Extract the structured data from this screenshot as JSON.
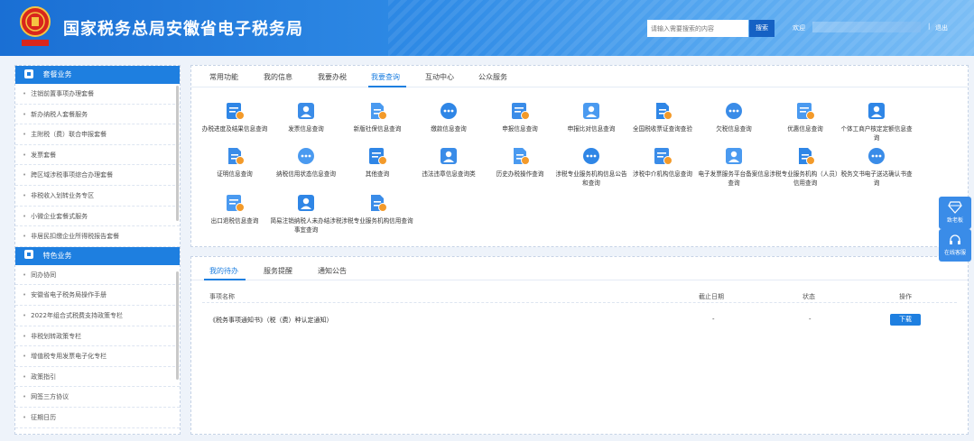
{
  "header": {
    "title": "国家税务总局安徽省电子税务局",
    "search_placeholder": "请输入需要搜索的内容",
    "search_button": "搜索",
    "welcome": "欢迎",
    "separator": "|",
    "logout": "退出",
    "colors": {
      "brand": "#1a6fd4",
      "brand_light": "#7cbef5"
    }
  },
  "sidebar": {
    "sections": [
      {
        "title": "套餐业务",
        "items": [
          "注销前置事项办理套餐",
          "新办纳税人套餐服务",
          "主附税（费）联合申报套餐",
          "发票套餐",
          "跨区域涉税事项综合办理套餐",
          "非税收入划转业务专区",
          "小微企业套餐式服务",
          "非居民扣缴企业所得税报告套餐"
        ]
      },
      {
        "title": "特色业务",
        "items": [
          "同办协同",
          "安徽省电子税务局操作手册",
          "2022年组合式税费支持政策专栏",
          "非税划转政策专栏",
          "增值税专用发票电子化专栏",
          "政策指引",
          "网签三方协议",
          "征期日历"
        ]
      }
    ]
  },
  "main_tabs": {
    "tabs": [
      "常用功能",
      "我的信息",
      "我要办税",
      "我要查询",
      "互动中心",
      "公众服务"
    ],
    "active": "我要查询"
  },
  "query_items": [
    {
      "label": "办税进度及结果信息查询",
      "icon": "search-progress-icon"
    },
    {
      "label": "发票信息查询",
      "icon": "invoice-icon"
    },
    {
      "label": "新版社保信息查询",
      "icon": "social-security-icon"
    },
    {
      "label": "缴款信息查询",
      "icon": "payment-icon"
    },
    {
      "label": "申报信息查询",
      "icon": "declaration-icon"
    },
    {
      "label": "申报比对信息查询",
      "icon": "compare-icon"
    },
    {
      "label": "全国税收票证查询查验",
      "icon": "tax-ticket-icon"
    },
    {
      "label": "欠税信息查询",
      "icon": "arrears-icon"
    },
    {
      "label": "优惠信息查询",
      "icon": "preferential-icon"
    },
    {
      "label": "个体工商户核定定额信息查询",
      "icon": "quota-icon"
    },
    {
      "label": "证明信息查询",
      "icon": "certificate-icon"
    },
    {
      "label": "纳税信用状态信息查询",
      "icon": "credit-icon"
    },
    {
      "label": "其他查询",
      "icon": "more-icon"
    },
    {
      "label": "违法违章信息查询类",
      "icon": "violation-icon"
    },
    {
      "label": "历史办税操作查询",
      "icon": "history-icon"
    },
    {
      "label": "涉税专业服务机构信息公告和查询",
      "icon": "agency-icon"
    },
    {
      "label": "涉税中介机构信息查询",
      "icon": "intermediary-icon"
    },
    {
      "label": "电子发票服务平台备案信息查询",
      "icon": "e-invoice-icon"
    },
    {
      "label": "涉税专业服务机构（人员）信用查询",
      "icon": "agency-staff-icon"
    },
    {
      "label": "税务文书电子送达确认书查询",
      "icon": "document-icon"
    },
    {
      "label": "出口退税信息查询",
      "icon": "export-refund-icon"
    },
    {
      "label": "简易注销纳税人未办结涉税事宜查询",
      "icon": "deregister-icon"
    },
    {
      "label": "涉税专业服务机构信用查询",
      "icon": "agency-credit-icon"
    }
  ],
  "bottom_tabs": {
    "tabs": [
      "我的待办",
      "服务提醒",
      "通知公告"
    ],
    "active": "我的待办"
  },
  "todo_table": {
    "headers": {
      "name": "事项名称",
      "deadline": "截止日期",
      "status": "状态",
      "action": "操作"
    },
    "rows": [
      {
        "name": "《税务事项通知书》（税（费）种认定通知）",
        "deadline": "-",
        "status": "-",
        "action": "下载"
      }
    ]
  },
  "floating": {
    "feedback": "致老板",
    "service": "在线客服"
  }
}
